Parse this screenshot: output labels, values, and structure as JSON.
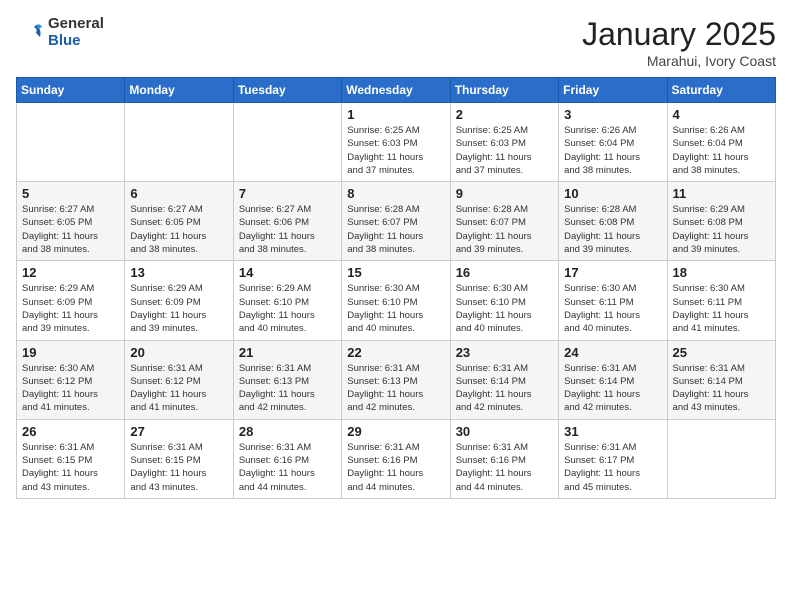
{
  "header": {
    "logo_general": "General",
    "logo_blue": "Blue",
    "month_title": "January 2025",
    "location": "Marahui, Ivory Coast"
  },
  "days_of_week": [
    "Sunday",
    "Monday",
    "Tuesday",
    "Wednesday",
    "Thursday",
    "Friday",
    "Saturday"
  ],
  "weeks": [
    [
      {
        "day": "",
        "info": ""
      },
      {
        "day": "",
        "info": ""
      },
      {
        "day": "",
        "info": ""
      },
      {
        "day": "1",
        "info": "Sunrise: 6:25 AM\nSunset: 6:03 PM\nDaylight: 11 hours\nand 37 minutes."
      },
      {
        "day": "2",
        "info": "Sunrise: 6:25 AM\nSunset: 6:03 PM\nDaylight: 11 hours\nand 37 minutes."
      },
      {
        "day": "3",
        "info": "Sunrise: 6:26 AM\nSunset: 6:04 PM\nDaylight: 11 hours\nand 38 minutes."
      },
      {
        "day": "4",
        "info": "Sunrise: 6:26 AM\nSunset: 6:04 PM\nDaylight: 11 hours\nand 38 minutes."
      }
    ],
    [
      {
        "day": "5",
        "info": "Sunrise: 6:27 AM\nSunset: 6:05 PM\nDaylight: 11 hours\nand 38 minutes."
      },
      {
        "day": "6",
        "info": "Sunrise: 6:27 AM\nSunset: 6:05 PM\nDaylight: 11 hours\nand 38 minutes."
      },
      {
        "day": "7",
        "info": "Sunrise: 6:27 AM\nSunset: 6:06 PM\nDaylight: 11 hours\nand 38 minutes."
      },
      {
        "day": "8",
        "info": "Sunrise: 6:28 AM\nSunset: 6:07 PM\nDaylight: 11 hours\nand 38 minutes."
      },
      {
        "day": "9",
        "info": "Sunrise: 6:28 AM\nSunset: 6:07 PM\nDaylight: 11 hours\nand 39 minutes."
      },
      {
        "day": "10",
        "info": "Sunrise: 6:28 AM\nSunset: 6:08 PM\nDaylight: 11 hours\nand 39 minutes."
      },
      {
        "day": "11",
        "info": "Sunrise: 6:29 AM\nSunset: 6:08 PM\nDaylight: 11 hours\nand 39 minutes."
      }
    ],
    [
      {
        "day": "12",
        "info": "Sunrise: 6:29 AM\nSunset: 6:09 PM\nDaylight: 11 hours\nand 39 minutes."
      },
      {
        "day": "13",
        "info": "Sunrise: 6:29 AM\nSunset: 6:09 PM\nDaylight: 11 hours\nand 39 minutes."
      },
      {
        "day": "14",
        "info": "Sunrise: 6:29 AM\nSunset: 6:10 PM\nDaylight: 11 hours\nand 40 minutes."
      },
      {
        "day": "15",
        "info": "Sunrise: 6:30 AM\nSunset: 6:10 PM\nDaylight: 11 hours\nand 40 minutes."
      },
      {
        "day": "16",
        "info": "Sunrise: 6:30 AM\nSunset: 6:10 PM\nDaylight: 11 hours\nand 40 minutes."
      },
      {
        "day": "17",
        "info": "Sunrise: 6:30 AM\nSunset: 6:11 PM\nDaylight: 11 hours\nand 40 minutes."
      },
      {
        "day": "18",
        "info": "Sunrise: 6:30 AM\nSunset: 6:11 PM\nDaylight: 11 hours\nand 41 minutes."
      }
    ],
    [
      {
        "day": "19",
        "info": "Sunrise: 6:30 AM\nSunset: 6:12 PM\nDaylight: 11 hours\nand 41 minutes."
      },
      {
        "day": "20",
        "info": "Sunrise: 6:31 AM\nSunset: 6:12 PM\nDaylight: 11 hours\nand 41 minutes."
      },
      {
        "day": "21",
        "info": "Sunrise: 6:31 AM\nSunset: 6:13 PM\nDaylight: 11 hours\nand 42 minutes."
      },
      {
        "day": "22",
        "info": "Sunrise: 6:31 AM\nSunset: 6:13 PM\nDaylight: 11 hours\nand 42 minutes."
      },
      {
        "day": "23",
        "info": "Sunrise: 6:31 AM\nSunset: 6:14 PM\nDaylight: 11 hours\nand 42 minutes."
      },
      {
        "day": "24",
        "info": "Sunrise: 6:31 AM\nSunset: 6:14 PM\nDaylight: 11 hours\nand 42 minutes."
      },
      {
        "day": "25",
        "info": "Sunrise: 6:31 AM\nSunset: 6:14 PM\nDaylight: 11 hours\nand 43 minutes."
      }
    ],
    [
      {
        "day": "26",
        "info": "Sunrise: 6:31 AM\nSunset: 6:15 PM\nDaylight: 11 hours\nand 43 minutes."
      },
      {
        "day": "27",
        "info": "Sunrise: 6:31 AM\nSunset: 6:15 PM\nDaylight: 11 hours\nand 43 minutes."
      },
      {
        "day": "28",
        "info": "Sunrise: 6:31 AM\nSunset: 6:16 PM\nDaylight: 11 hours\nand 44 minutes."
      },
      {
        "day": "29",
        "info": "Sunrise: 6:31 AM\nSunset: 6:16 PM\nDaylight: 11 hours\nand 44 minutes."
      },
      {
        "day": "30",
        "info": "Sunrise: 6:31 AM\nSunset: 6:16 PM\nDaylight: 11 hours\nand 44 minutes."
      },
      {
        "day": "31",
        "info": "Sunrise: 6:31 AM\nSunset: 6:17 PM\nDaylight: 11 hours\nand 45 minutes."
      },
      {
        "day": "",
        "info": ""
      }
    ]
  ]
}
